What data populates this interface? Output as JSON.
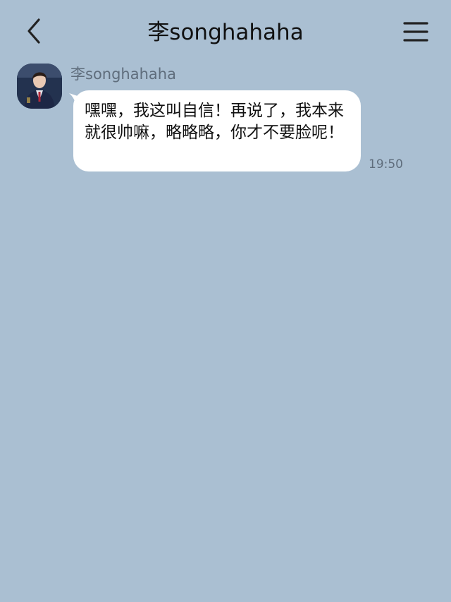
{
  "header": {
    "title": "李songhahaha",
    "back_icon": "chevron-left-icon",
    "menu_icon": "hamburger-menu-icon"
  },
  "message": {
    "sender": "李songhahaha",
    "text": "嘿嘿，我这叫自信！再说了，我本来就很帅嘛，略略略，你才不要脸呢！",
    "time": "19:50"
  },
  "colors": {
    "background": "#aabfd2",
    "bubble": "#ffffff",
    "meta_text": "#5f6d7c",
    "title_text": "#111111"
  }
}
